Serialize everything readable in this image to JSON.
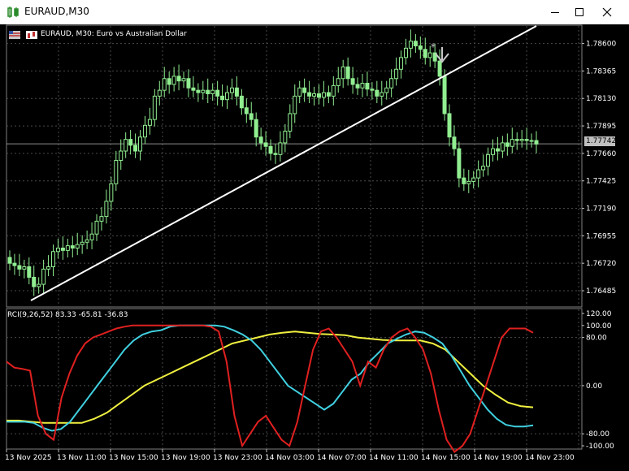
{
  "window": {
    "title": "EURAUD,M30",
    "controls": [
      "minimize",
      "maximize",
      "close"
    ]
  },
  "chart": {
    "symbol_label": "EURAUD, M30:  Euro vs Australian Dollar",
    "current_price": "1.77742",
    "price_axis": [
      "1.78600",
      "1.78365",
      "1.78130",
      "1.77895",
      "1.77660",
      "1.77425",
      "1.77190",
      "1.76955",
      "1.76720",
      "1.76485"
    ],
    "time_axis": [
      "13 Nov 2025",
      "13 Nov 11:00",
      "13 Nov 15:00",
      "13 Nov 19:00",
      "13 Nov 23:00",
      "14 Nov 03:00",
      "14 Nov 07:00",
      "14 Nov 11:00",
      "14 Nov 15:00",
      "14 Nov 19:00",
      "14 Nov 23:00"
    ],
    "indicator_label": "RCI(9,26,52) 83.33 -65.81 -36.83",
    "indicator_axis": [
      "120.00",
      "100.00",
      "80.00",
      "0.00",
      "-80.00",
      "-100.00"
    ],
    "colors": {
      "background": "#000000",
      "candle": "#90ee90",
      "trendline": "#ffffff",
      "rci_fast": "#e02020",
      "rci_mid": "#40d0e0",
      "rci_slow": "#f0f040"
    }
  },
  "chart_data": {
    "type": "candlestick",
    "ylim": [
      1.7636,
      1.7875
    ],
    "closes": [
      1.7672,
      1.767,
      1.7667,
      1.7669,
      1.766,
      1.7652,
      1.7654,
      1.7667,
      1.7669,
      1.7682,
      1.7685,
      1.7683,
      1.7687,
      1.7685,
      1.7688,
      1.769,
      1.7692,
      1.7697,
      1.7708,
      1.7712,
      1.7725,
      1.774,
      1.776,
      1.7768,
      1.7778,
      1.7773,
      1.7768,
      1.778,
      1.779,
      1.7795,
      1.7815,
      1.782,
      1.783,
      1.7825,
      1.7832,
      1.7828,
      1.783,
      1.7822,
      1.782,
      1.7818,
      1.782,
      1.7817,
      1.782,
      1.7815,
      1.7812,
      1.7818,
      1.7822,
      1.7815,
      1.7805,
      1.78,
      1.7795,
      1.778,
      1.7775,
      1.7772,
      1.7766,
      1.7765,
      1.7775,
      1.7785,
      1.78,
      1.7815,
      1.7822,
      1.7818,
      1.7815,
      1.7817,
      1.7814,
      1.7818,
      1.7815,
      1.7824,
      1.783,
      1.784,
      1.783,
      1.7825,
      1.7822,
      1.7826,
      1.7821,
      1.782,
      1.7815,
      1.7818,
      1.7822,
      1.783,
      1.7838,
      1.7848,
      1.7856,
      1.7862,
      1.7858,
      1.7855,
      1.7848,
      1.7852,
      1.7845,
      1.7832,
      1.78,
      1.778,
      1.777,
      1.7745,
      1.774,
      1.7742,
      1.7745,
      1.7752,
      1.7755,
      1.7765,
      1.777,
      1.7768,
      1.7775,
      1.7772,
      1.7778,
      1.7777,
      1.7778,
      1.7777,
      1.7777,
      1.7774
    ],
    "rci_fast": [
      40,
      30,
      28,
      25,
      -50,
      -80,
      -90,
      -20,
      20,
      50,
      70,
      80,
      85,
      90,
      95,
      98,
      100,
      100,
      100,
      100,
      100,
      100,
      100,
      100,
      100,
      100,
      98,
      90,
      40,
      -50,
      -100,
      -80,
      -60,
      -50,
      -70,
      -90,
      -100,
      -60,
      0,
      60,
      90,
      95,
      80,
      60,
      40,
      0,
      40,
      30,
      60,
      80,
      90,
      95,
      80,
      60,
      20,
      -40,
      -90,
      -110,
      -100,
      -80,
      -40,
      0,
      40,
      80,
      95,
      95,
      95,
      88
    ],
    "rci_mid": [
      -60,
      -60,
      -60,
      -62,
      -70,
      -75,
      -72,
      -60,
      -40,
      -20,
      0,
      20,
      40,
      60,
      75,
      85,
      90,
      92,
      98,
      100,
      100,
      100,
      100,
      100,
      98,
      92,
      85,
      75,
      60,
      40,
      20,
      0,
      -10,
      -20,
      -30,
      -40,
      -30,
      -10,
      10,
      20,
      40,
      55,
      70,
      78,
      85,
      90,
      88,
      80,
      70,
      50,
      25,
      0,
      -20,
      -40,
      -55,
      -65,
      -68,
      -68,
      -66
    ],
    "rci_slow": [
      -58,
      -58,
      -60,
      -62,
      -62,
      -62,
      -62,
      -55,
      -45,
      -30,
      -15,
      0,
      10,
      20,
      30,
      40,
      50,
      60,
      70,
      75,
      80,
      85,
      88,
      90,
      88,
      86,
      85,
      84,
      80,
      78,
      76,
      75,
      75,
      75,
      70,
      60,
      40,
      20,
      0,
      -15,
      -28,
      -34,
      -36
    ]
  }
}
